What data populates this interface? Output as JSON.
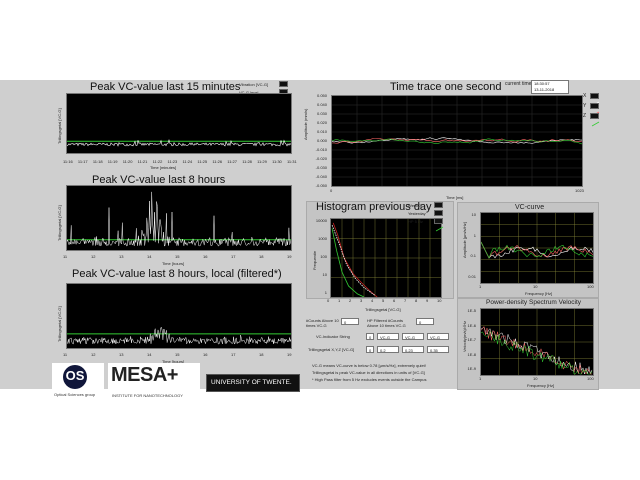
{
  "panel_left": {
    "p1": {
      "title": "Peak VC-value last 15 minutes",
      "ylabel": "Trillingsgetal [VC-G]",
      "xlabel": "Time [minutes]",
      "xticks": [
        "11:16",
        "11:17",
        "11:18",
        "11:19",
        "11:20",
        "11:21",
        "11:22",
        "11:23",
        "11:24",
        "11:25",
        "11:26",
        "11:27",
        "11:28",
        "11:29",
        "11:30",
        "11:31"
      ],
      "legend": [
        {
          "label": "Vibration [VC-G]",
          "color": "#ffffff"
        },
        {
          "label": "VC-G level",
          "color": "#33cc33"
        }
      ]
    },
    "p2": {
      "title": "Peak VC-value last 8 hours",
      "ylabel": "Trillingsgetal [VC-G]",
      "xlabel": "Time [hours]",
      "xticks": [
        "11",
        "12",
        "13",
        "14",
        "15",
        "16",
        "17",
        "18",
        "19"
      ]
    },
    "p3": {
      "title": "Peak VC-value last 8 hours, local (filtered*)",
      "ylabel": "Trillingsgetal [VC-G]",
      "xlabel": "Time [hours]",
      "xticks": [
        "11",
        "12",
        "13",
        "14",
        "15",
        "16",
        "17",
        "18",
        "19"
      ]
    }
  },
  "logos": {
    "os_letters": "OS",
    "os_caption": "Optical Sciences group",
    "mesa_name": "MESA+",
    "mesa_caption": "INSTITUTE FOR NANOTECHNOLOGY",
    "ut_name": "UNIVERSITY OF TWENTE."
  },
  "time_trace": {
    "title": "Time trace one second",
    "current_time_label": "current time",
    "current_time": "18:30:57",
    "current_date": "13-11-2018",
    "ylabel": "Amplitude (mm/s)",
    "xlabel": "Time [ms]",
    "x_start": "0",
    "x_end": "1023",
    "yticks": [
      "0.050",
      "0.040",
      "0.030",
      "0.020",
      "0.010",
      "0.000",
      "-0.010",
      "-0.020",
      "-0.030",
      "-0.040",
      "-0.050"
    ],
    "axes": [
      {
        "label": "X",
        "color": "#ffffff"
      },
      {
        "label": "Y",
        "color": "#ff6666"
      },
      {
        "label": "Z",
        "color": "#33cc33"
      }
    ]
  },
  "histogram": {
    "title": "Histogram previous day",
    "ylabel": "Frequentie",
    "xlabel": "Trillingsgetal [VC-G]",
    "xticks": [
      "0",
      "1",
      "2",
      "3",
      "4",
      "5",
      "6",
      "7",
      "8",
      "9",
      "10"
    ],
    "yticks": [
      "10000",
      "1000",
      "100",
      "10",
      "1"
    ],
    "legend": [
      {
        "label": "Week 3",
        "color": "#cc2222"
      },
      {
        "label": "Yesterday",
        "color": "#ffffff"
      },
      {
        "label": "HP 5 Hz",
        "color": "#33cc33"
      }
    ]
  },
  "vc_curve": {
    "title": "VC-curve",
    "ylabel": "Amplitude [µm/s/Hz]",
    "xlabel": "Frequency [Hz]",
    "xticks": [
      "1",
      "10",
      "100"
    ],
    "yticks": [
      "10",
      "1",
      "0.1",
      "0.01"
    ]
  },
  "psd": {
    "title": "Power-density Spectrum Velocity",
    "ylabel": "Velocity(m/s)/√Hz",
    "xlabel": "Frequency [Hz]",
    "xticks": [
      "1",
      "10",
      "100"
    ],
    "yticks": [
      "1E-5",
      "1E-6",
      "1E-7",
      "1E-8",
      "1E-9"
    ]
  },
  "indicators": {
    "counts_above_label": "#Counts Above 10 times VC-G",
    "counts_above_value": "0",
    "hp_counts_label": "HP Filtered #Counts Above 10 times VC-G",
    "hp_counts_value": "0",
    "vc_string_label": "VC-Indicator String",
    "vc_string_index": "0",
    "vc_strings": [
      "VC-G",
      "VC-G",
      "VC-G"
    ],
    "xyz_label": "Trillingsgetal X,Y,Z [VC-G]",
    "xyz_index": "0",
    "xyz_values": [
      "0.2",
      "0.23",
      "0.35"
    ]
  },
  "notes": [
    "VC-G means VC-curve is below 0.78 [µm/s/Hz], extremely quiet!",
    "Trillingsgetal is peak VC-value in all directions in units of [VC-G]",
    "* High Pass filter from 5 Hz excludes events outside the Campus"
  ]
}
